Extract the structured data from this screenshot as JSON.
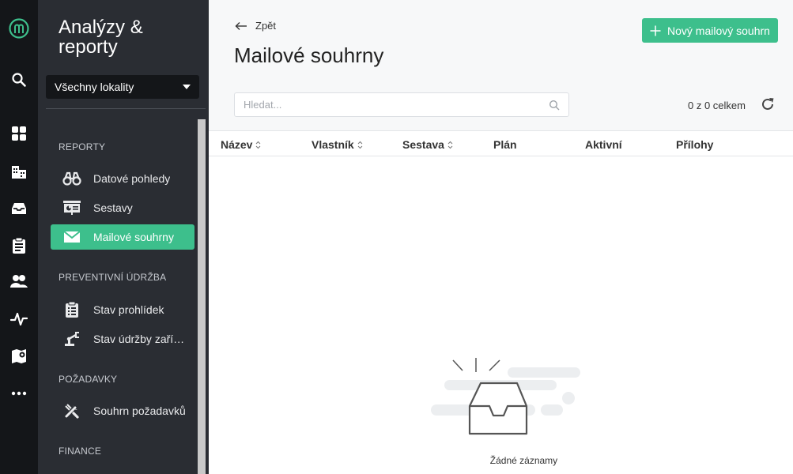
{
  "rail": {
    "items": [
      "logo-icon",
      "search-icon",
      "dashboard-icon",
      "buildings-icon",
      "inbox-icon",
      "clipboard-icon",
      "users-icon",
      "activity-icon",
      "map-pin-icon",
      "more-icon"
    ]
  },
  "menu": {
    "title": "Analýzy & reporty",
    "location_select": "Všechny lokality",
    "sections": [
      {
        "label": "REPORTY",
        "items": [
          {
            "label": "Datové pohledy",
            "icon": "binoculars-icon",
            "active": false
          },
          {
            "label": "Sestavy",
            "icon": "presentation-icon",
            "active": false
          },
          {
            "label": "Mailové souhrny",
            "icon": "envelope-icon",
            "active": true
          }
        ]
      },
      {
        "label": "PREVENTIVNÍ ÚDRŽBA",
        "items": [
          {
            "label": "Stav prohlídek",
            "icon": "clipboard-list-icon",
            "active": false
          },
          {
            "label": "Stav údržby zařízení",
            "icon": "machine-arm-icon",
            "active": false
          }
        ]
      },
      {
        "label": "POŽADAVKY",
        "items": [
          {
            "label": "Souhrn požadavků",
            "icon": "tools-icon",
            "active": false
          }
        ]
      },
      {
        "label": "FINANCE",
        "items": []
      }
    ]
  },
  "main": {
    "back_label": "Zpět",
    "title": "Mailové souhrny",
    "new_button": "Nový mailový souhrn",
    "search_placeholder": "Hledat...",
    "count": "0 z 0 celkem",
    "columns": [
      {
        "label": "Název",
        "sortable": true
      },
      {
        "label": "Vlastník",
        "sortable": true
      },
      {
        "label": "Sestava",
        "sortable": true
      },
      {
        "label": "Plán",
        "sortable": false
      },
      {
        "label": "Aktivní",
        "sortable": false
      },
      {
        "label": "Přílohy",
        "sortable": false
      }
    ],
    "empty_text": "Žádné záznamy"
  },
  "colors": {
    "accent": "#3dbf8c",
    "rail_bg": "#141619",
    "menu_bg": "#2a2d33"
  }
}
